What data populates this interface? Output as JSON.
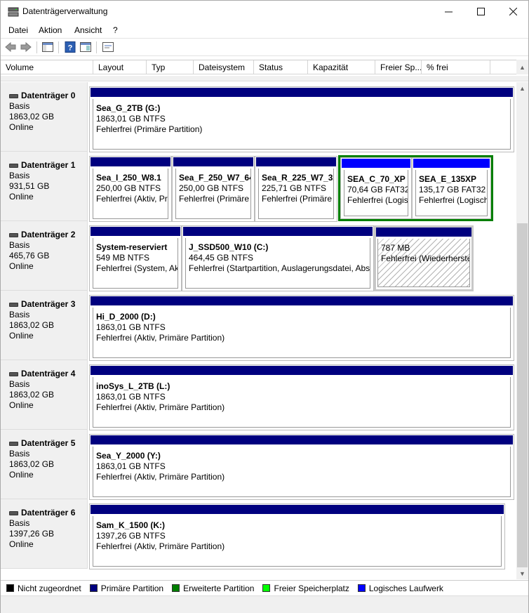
{
  "window": {
    "title": "Datenträgerverwaltung"
  },
  "menu": [
    "Datei",
    "Aktion",
    "Ansicht",
    "?"
  ],
  "columns": [
    "Volume",
    "Layout",
    "Typ",
    "Dateisystem",
    "Status",
    "Kapazität",
    "Freier Sp...",
    "% frei"
  ],
  "disks": [
    {
      "name": "Datenträger 0",
      "type": "Basis",
      "size": "1863,02 GB",
      "state": "Online",
      "partitions": [
        {
          "name": "Sea_G_2TB  (G:)",
          "fs": "1863,01 GB NTFS",
          "status": "Fehlerfrei (Primäre Partition)"
        }
      ]
    },
    {
      "name": "Datenträger 1",
      "type": "Basis",
      "size": "931,51 GB",
      "state": "Online",
      "partitions": [
        {
          "name": "Sea_I_250_W8.1",
          "fs": "250,00 GB NTFS",
          "status": "Fehlerfrei (Aktiv, Pri"
        },
        {
          "name": "Sea_F_250_W7_64",
          "fs": "250,00 GB NTFS",
          "status": "Fehlerfrei (Primäre I"
        },
        {
          "name": "Sea_R_225_W7_32",
          "fs": "225,71 GB NTFS",
          "status": "Fehlerfrei (Primäre I"
        },
        {
          "name": "SEA_C_70_XP",
          "fs": "70,64 GB FAT32",
          "status": "Fehlerfrei (Logis"
        },
        {
          "name": "SEA_E_135XP",
          "fs": "135,17 GB FAT32",
          "status": "Fehlerfrei (Logisch"
        }
      ]
    },
    {
      "name": "Datenträger 2",
      "type": "Basis",
      "size": "465,76 GB",
      "state": "Online",
      "partitions": [
        {
          "name": "System-reserviert",
          "fs": "549 MB NTFS",
          "status": "Fehlerfrei (System, Akt"
        },
        {
          "name": "J_SSD500_W10  (C:)",
          "fs": "464,45 GB NTFS",
          "status": "Fehlerfrei (Startpartition, Auslagerungsdatei, Abst"
        },
        {
          "name": "",
          "fs": "787 MB",
          "status": "Fehlerfrei (Wiederherste"
        }
      ]
    },
    {
      "name": "Datenträger 3",
      "type": "Basis",
      "size": "1863,02 GB",
      "state": "Online",
      "partitions": [
        {
          "name": "Hi_D_2000  (D:)",
          "fs": "1863,01 GB NTFS",
          "status": "Fehlerfrei (Aktiv, Primäre Partition)"
        }
      ]
    },
    {
      "name": "Datenträger 4",
      "type": "Basis",
      "size": "1863,02 GB",
      "state": "Online",
      "partitions": [
        {
          "name": "inoSys_L_2TB  (L:)",
          "fs": "1863,01 GB NTFS",
          "status": "Fehlerfrei (Aktiv, Primäre Partition)"
        }
      ]
    },
    {
      "name": "Datenträger 5",
      "type": "Basis",
      "size": "1863,02 GB",
      "state": "Online",
      "partitions": [
        {
          "name": "Sea_Y_2000  (Y:)",
          "fs": "1863,01 GB NTFS",
          "status": "Fehlerfrei (Aktiv, Primäre Partition)"
        }
      ]
    },
    {
      "name": "Datenträger 6",
      "type": "Basis",
      "size": "1397,26 GB",
      "state": "Online",
      "partitions": [
        {
          "name": "Sam_K_1500  (K:)",
          "fs": "1397,26 GB NTFS",
          "status": "Fehlerfrei (Aktiv, Primäre Partition)"
        }
      ]
    }
  ],
  "legend": [
    {
      "label": "Nicht zugeordnet",
      "color": "#000000"
    },
    {
      "label": "Primäre Partition",
      "color": "#00007f"
    },
    {
      "label": "Erweiterte Partition",
      "color": "#007f00"
    },
    {
      "label": "Freier Speicherplatz",
      "color": "#00ff00"
    },
    {
      "label": "Logisches Laufwerk",
      "color": "#0000ff"
    }
  ],
  "colors": {
    "primary": "#00007f",
    "logical": "#0000ff",
    "extended": "#007f00"
  }
}
